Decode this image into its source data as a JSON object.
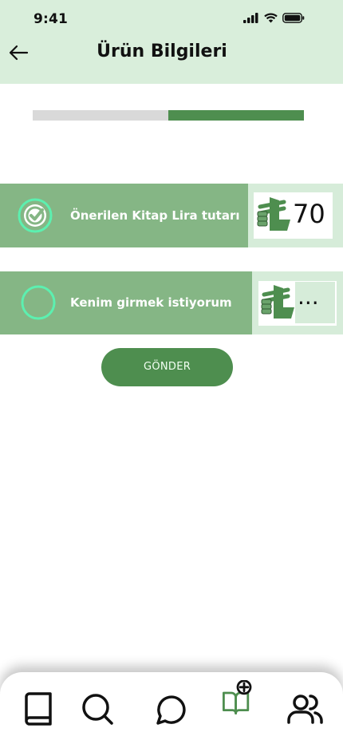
{
  "status_bar": {
    "time": "9:41"
  },
  "header": {
    "title": "Ürün Bilgileri"
  },
  "progress": {
    "value": 0.5
  },
  "options": [
    {
      "label": "Önerilen Kitap Lira tutarı",
      "price": "70",
      "selected": true,
      "currency_icon": "lira-money-icon"
    },
    {
      "label": "Kenim girmek istiyorum",
      "price": "...",
      "selected": false,
      "currency_icon": "lira-money-icon"
    }
  ],
  "submit": {
    "label": "GÖNDER"
  },
  "tabbar": {
    "items": [
      "book-icon",
      "search-icon",
      "chat-icon",
      "add-book-icon",
      "users-icon"
    ],
    "active": "add-book-icon"
  },
  "colors": {
    "accent": "#4e8e4f",
    "light": "#d9eedb",
    "bar": "#85b685",
    "check": "#5cf0b0"
  }
}
